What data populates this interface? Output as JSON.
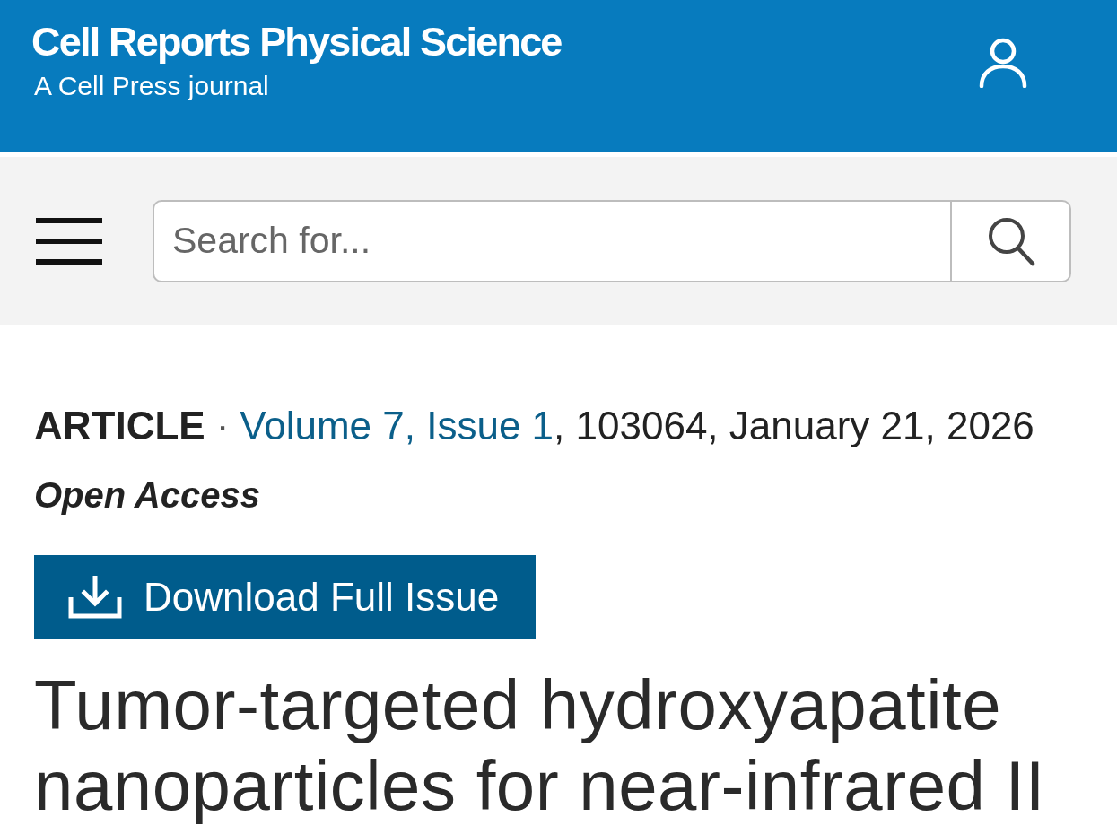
{
  "header": {
    "journal_title": "Cell Reports Physical Science",
    "subtitle": "A Cell Press journal"
  },
  "search": {
    "placeholder": "Search for..."
  },
  "article": {
    "type": "ARTICLE",
    "separator": "·",
    "issue_link": "Volume 7, Issue 1",
    "details": ", 103064, January 21, 2026",
    "access": "Open Access",
    "download_button": "Download Full Issue",
    "title": "Tumor-targeted hydroxyapatite nanoparticles for near-infrared II"
  }
}
